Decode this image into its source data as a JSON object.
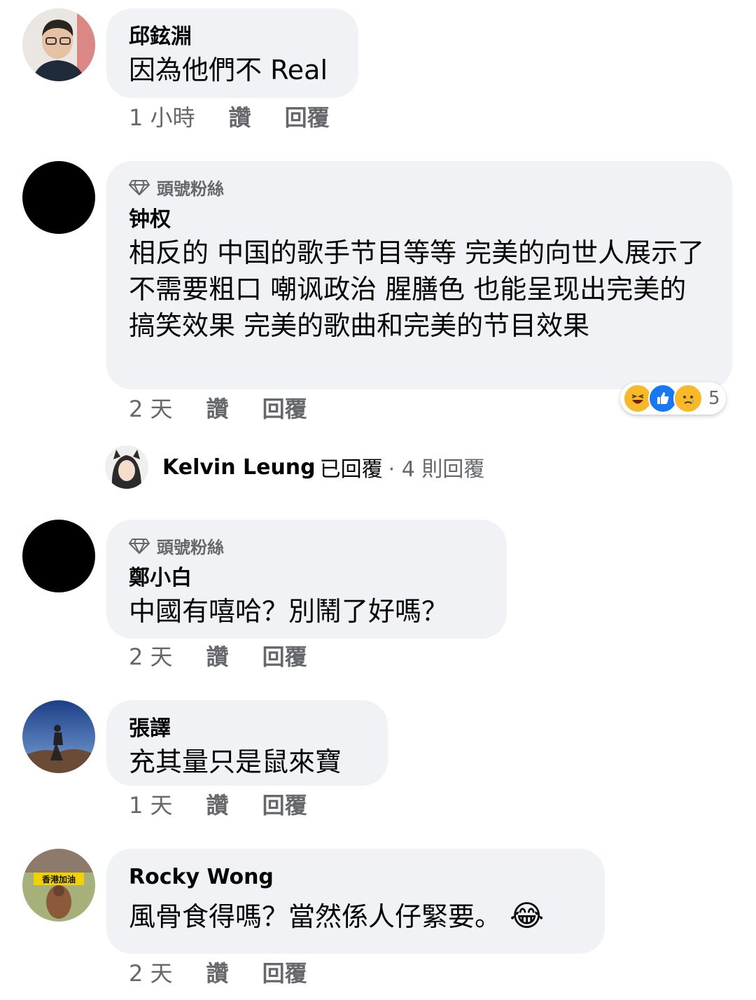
{
  "comments": [
    {
      "author": "邱鉉淵",
      "text": "因為他們不 Real",
      "time": "1 小時",
      "like": "讚",
      "reply": "回覆"
    },
    {
      "badge": "頭號粉絲",
      "author": "钟权",
      "text": "相反的 中国的歌手节目等等 完美的向世人展示了 不需要粗口 嘲讽政治 腥膳色 也能呈现出完美的搞笑效果 完美的歌曲和完美的节目效果",
      "time": "2 天",
      "like": "讚",
      "reply": "回覆",
      "reaction_count": "5",
      "reaction_icons": [
        "laugh-emoji",
        "like-icon",
        "sad-emoji"
      ]
    },
    {
      "badge": "頭號粉絲",
      "author": "鄭小白",
      "text": "中國有嘻哈？別鬧了好嗎？",
      "time": "2 天",
      "like": "讚",
      "reply": "回覆"
    },
    {
      "author": "張譯",
      "text": "充其量只是鼠來寶",
      "time": "1 天",
      "like": "讚",
      "reply": "回覆"
    },
    {
      "author": "Rocky Wong",
      "text": "風骨食得嗎？當然係人仔緊要。",
      "emoji": "😂",
      "time": "2 天",
      "like": "讚",
      "reply": "回覆"
    }
  ],
  "reply_summary": {
    "name": "Kelvin Leung",
    "rest": "已回覆",
    "count": "· 4 則回覆"
  },
  "avatar_sign_text": "香港加油",
  "colors": {
    "bubble": "#f0f2f5",
    "meta": "#65676b",
    "text": "#050505",
    "like_blue": "#1877f2",
    "emoji_yellow": "#f7b928"
  }
}
